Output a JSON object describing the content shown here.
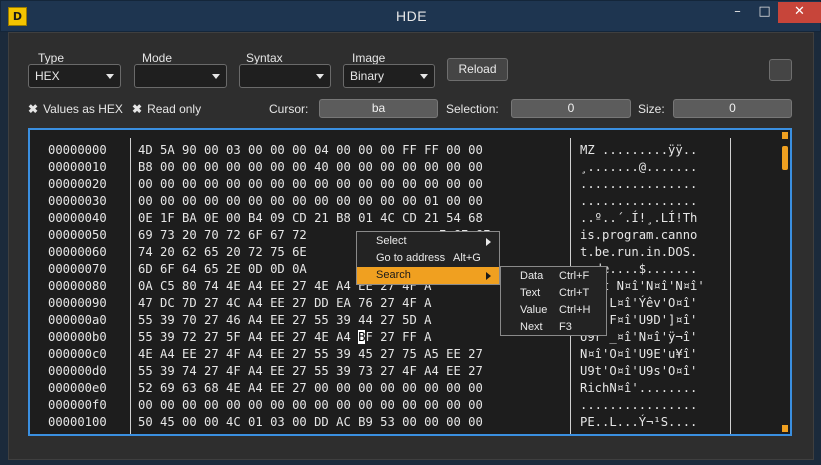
{
  "window": {
    "title": "HDE",
    "app_icon_text": "D",
    "min": "–",
    "max": "□",
    "close": "✕"
  },
  "toolbar": {
    "type": {
      "label": "Type",
      "value": "HEX"
    },
    "mode": {
      "label": "Mode",
      "value": ""
    },
    "syntax": {
      "label": "Syntax",
      "value": ""
    },
    "image": {
      "label": "Image",
      "value": "Binary"
    },
    "reload": "Reload"
  },
  "options": {
    "check_mark": "✖",
    "values_as_hex": "Values as HEX",
    "read_only": "Read only",
    "cursor_label": "Cursor:",
    "cursor_value": "ba",
    "selection_label": "Selection:",
    "selection_value": "0",
    "size_label": "Size:",
    "size_value": "0"
  },
  "hex": {
    "offsets": [
      "00000000",
      "00000010",
      "00000020",
      "00000030",
      "00000040",
      "00000050",
      "00000060",
      "00000070",
      "00000080",
      "00000090",
      "000000a0",
      "000000b0",
      "000000c0",
      "000000d0",
      "000000e0",
      "000000f0",
      "00000100"
    ],
    "rows": [
      "4D 5A 90 00 03 00 00 00 04 00 00 00 FF FF 00 00",
      "B8 00 00 00 00 00 00 00 40 00 00 00 00 00 00 00",
      "00 00 00 00 00 00 00 00 00 00 00 00 00 00 00 00",
      "00 00 00 00 00 00 00 00 00 00 00 00 00 01 00 00",
      "0E 1F BA 0E 00 B4 09 CD 21 B8 01 4C CD 21 54 68",
      "69 73 20 70 72 6F 67 72                  E 6E 6F",
      "74 20 62 65 20 72 75 6E                  F 53 20",
      "6D 6F 64 65 2E 0D 0D 0A                       ",
      "0A C5 80 74 4E A4 EE 27 4E A4 EE 27 4F A   ",
      "47 DC 7D 27 4C A4 EE 27 DD EA 76 27 4F A   ",
      "55 39 70 27 46 A4 EE 27 55 39 44 27 5D A   ",
      "55 39 72 27 5F A4 EE 27 4E A4  F 27 FF A   ",
      "4E A4 EE 27 4F A4 EE 27 55 39 45 27 75 A5 EE 27",
      "55 39 74 27 4F A4 EE 27 55 39 73 27 4F A4 EE 27",
      "52 69 63 68 4E A4 EE 27 00 00 00 00 00 00 00 00",
      "00 00 00 00 00 00 00 00 00 00 00 00 00 00 00 00",
      "50 45 00 00 4C 01 03 00 DD AC B9 53 00 00 00 00"
    ],
    "cursor_byte": "B",
    "ascii": [
      "MZ .........ÿÿ..",
      "¸.......@.......",
      "................",
      "................",
      "..º..´.Í!¸.LÍ!Th",
      "is.program.canno",
      "t.be.run.in.DOS.",
      "mode....$.......",
      "‘¬€t N¤î'N¤î'N¤î'",
      "GÜ}'L¤î'Ýêv'O¤î'",
      "U9p'F¤î'U9D']¤î'",
      "U9r'_¤î'N¤î'ÿ¬î'",
      "N¤î'O¤î'U9E'u¥î'",
      "U9t'O¤î'U9s'O¤î'",
      "RichN¤î'........",
      "................",
      "PE..L...Ý¬¹S...."
    ]
  },
  "context_menu": {
    "items": [
      {
        "label": "Select",
        "shortcut": ""
      },
      {
        "label": "Go to address",
        "shortcut": "Alt+G"
      },
      {
        "label": "Search",
        "shortcut": ""
      }
    ]
  },
  "search_submenu": {
    "items": [
      {
        "label": "Data",
        "shortcut": "Ctrl+F"
      },
      {
        "label": "Text",
        "shortcut": "Ctrl+T"
      },
      {
        "label": "Value",
        "shortcut": "Ctrl+H"
      },
      {
        "label": "Next",
        "shortcut": "F3"
      }
    ]
  },
  "colors": {
    "accent": "#3a8fe0",
    "highlight": "#f0a020",
    "close": "#c7453a"
  }
}
